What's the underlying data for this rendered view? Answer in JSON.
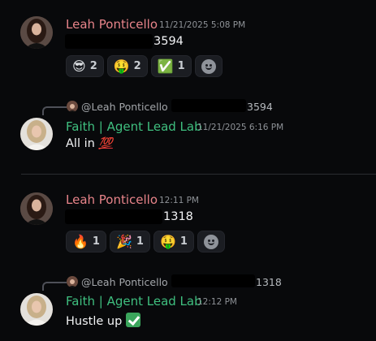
{
  "messages": [
    {
      "author": "Leah Ponticello",
      "timestamp": "11/21/2025 5:08 PM",
      "text_visible": "3594",
      "reactions": [
        {
          "emoji": "😎",
          "count": "2"
        },
        {
          "emoji": "🤑",
          "count": "2"
        },
        {
          "emoji": "✅",
          "count": "1"
        }
      ]
    },
    {
      "reply_to": {
        "author": "@Leah Ponticello",
        "text_visible": "3594"
      },
      "author": "Faith | Agent Lead Lab",
      "timestamp": "11/21/2025 6:16 PM",
      "text": "All in",
      "emoji": "💯"
    },
    {
      "author": "Leah Ponticello",
      "timestamp": "12:11 PM",
      "text_visible": "1318",
      "reactions": [
        {
          "emoji": "🔥",
          "count": "1"
        },
        {
          "emoji": "🎉",
          "count": "1"
        },
        {
          "emoji": "🤑",
          "count": "1"
        }
      ]
    },
    {
      "reply_to": {
        "author": "@Leah Ponticello",
        "text_visible": "1318"
      },
      "author": "Faith | Agent Lead Lab",
      "timestamp": "12:12 PM",
      "text": "Hustle up"
    }
  ],
  "icons": {
    "add_reaction": "smiley-add-reaction-icon",
    "checkmark": "white-check-mark-icon"
  },
  "colors": {
    "background": "#08090b",
    "leah_name": "#e8848a",
    "faith_name": "#3fbf7f",
    "reaction_bg": "#1b1d22"
  }
}
